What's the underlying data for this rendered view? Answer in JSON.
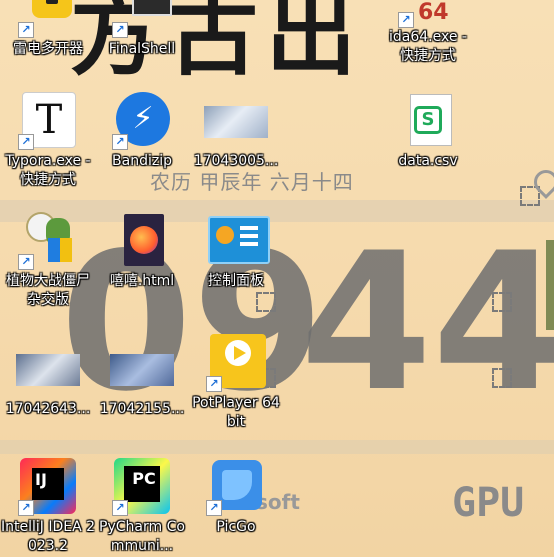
{
  "wallpaper": {
    "lunar_date": "农历 甲辰年 六月十四",
    "clock_hour": "09",
    "clock_minute": "44",
    "top_glyphs": "方古出",
    "badge_gpu": "GPU",
    "badge_soft": "soft"
  },
  "icons": [
    {
      "label": "雷电多开器",
      "icon": "leidian-icon",
      "shortcut": true
    },
    {
      "label": "FinalShell",
      "icon": "finalshell-icon",
      "shortcut": true
    },
    {
      "label": "ida64.exe - 快捷方式",
      "icon": "ida64-icon",
      "shortcut": true
    },
    {
      "label": "Typora.exe - 快捷方式",
      "icon": "typora-icon",
      "shortcut": true
    },
    {
      "label": "Bandizip",
      "icon": "bandizip-icon",
      "shortcut": true
    },
    {
      "label": "17043005...",
      "icon": "image-thumbnail-icon",
      "shortcut": false
    },
    {
      "label": "data.csv",
      "icon": "csv-file-icon",
      "shortcut": false
    },
    {
      "label": "植物大战僵尸杂交版",
      "icon": "plants-vs-zombies-icon",
      "shortcut": true
    },
    {
      "label": "嘻嘻.html",
      "icon": "firefox-html-icon",
      "shortcut": false
    },
    {
      "label": "控制面板",
      "icon": "control-panel-icon",
      "shortcut": true
    },
    {
      "label": "17042643...",
      "icon": "image-thumbnail-icon",
      "shortcut": false
    },
    {
      "label": "17042155...",
      "icon": "image-thumbnail-icon",
      "shortcut": false
    },
    {
      "label": "PotPlayer 64 bit",
      "icon": "potplayer-icon",
      "shortcut": true
    },
    {
      "label": "IntelliJ IDEA 2023.2",
      "icon": "intellij-idea-icon",
      "shortcut": true
    },
    {
      "label": "PyCharm Communi...",
      "icon": "pycharm-icon",
      "shortcut": true
    },
    {
      "label": "PicGo",
      "icon": "picgo-icon",
      "shortcut": true
    }
  ],
  "colors": {
    "wallpaper": "#f6dcb0",
    "label_text": "#ffffff"
  }
}
